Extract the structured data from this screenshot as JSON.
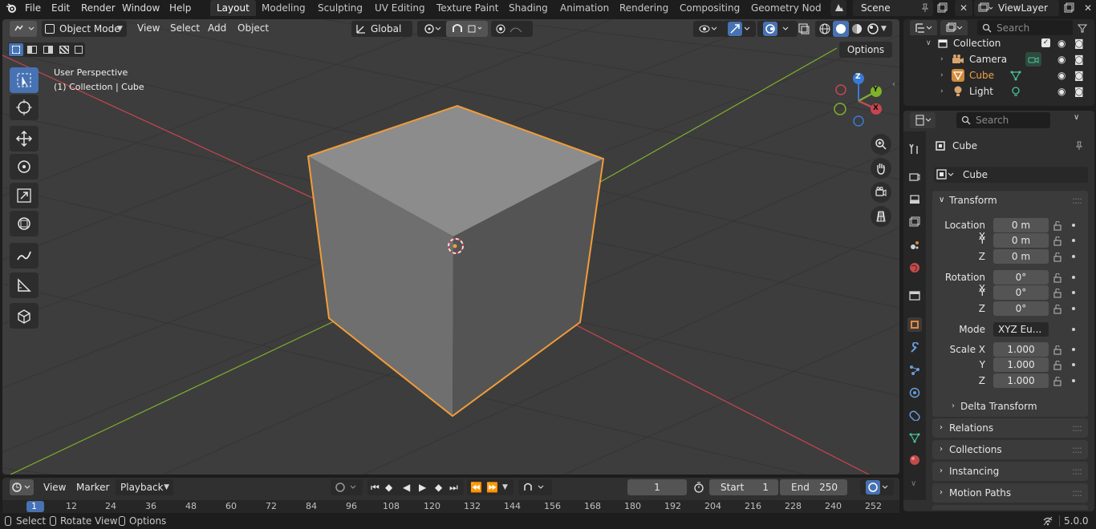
{
  "app": {
    "menu": [
      "File",
      "Edit",
      "Render",
      "Window",
      "Help"
    ],
    "workspaces": [
      "Layout",
      "Modeling",
      "Sculpting",
      "UV Editing",
      "Texture Paint",
      "Shading",
      "Animation",
      "Rendering",
      "Compositing",
      "Geometry Nodes"
    ],
    "active_workspace": "Layout",
    "scene_name": "Scene",
    "view_layer": "ViewLayer",
    "version": "5.0.0"
  },
  "viewport": {
    "mode": "Object Mode",
    "menus": [
      "View",
      "Select",
      "Add",
      "Object"
    ],
    "transform_orientation": "Global",
    "options_label": "Options",
    "perspective_label": "User Perspective",
    "context_label": "(1) Collection | Cube",
    "gizmo_axes": {
      "x": "X",
      "y": "Y",
      "z": "Z"
    },
    "colors": {
      "accent": "#4772b3",
      "selection": "#f29c38",
      "x_axis": "#c8454f",
      "y_axis": "#7fb12a",
      "z_axis": "#3a7ad6"
    }
  },
  "timeline": {
    "menus": [
      "View",
      "Marker",
      "Playback"
    ],
    "current_frame": "1",
    "start_label": "Start",
    "start_value": "1",
    "end_label": "End",
    "end_value": "250",
    "ruler": [
      "1",
      "12",
      "24",
      "36",
      "48",
      "60",
      "72",
      "84",
      "96",
      "108",
      "120",
      "132",
      "144",
      "156",
      "168",
      "180",
      "192",
      "204",
      "216",
      "228",
      "240",
      "252"
    ]
  },
  "outliner": {
    "search_placeholder": "Search",
    "collection": "Collection",
    "items": [
      {
        "name": "Camera",
        "icon": "camera-icon"
      },
      {
        "name": "Cube",
        "icon": "mesh-icon",
        "selected": true
      },
      {
        "name": "Light",
        "icon": "light-icon"
      }
    ]
  },
  "properties": {
    "search_placeholder": "Search",
    "object_name": "Cube",
    "data_name": "Cube",
    "transform_label": "Transform",
    "location_label": "Location X",
    "rotation_label": "Rotation X",
    "scale_label": "Scale X",
    "y_label": "Y",
    "z_label": "Z",
    "location": [
      "0 m",
      "0 m",
      "0 m"
    ],
    "rotation": [
      "0°",
      "0°",
      "0°"
    ],
    "mode_label": "Mode",
    "mode_value": "XYZ Eu...",
    "scale": [
      "1.000",
      "1.000",
      "1.000"
    ],
    "delta_transform": "Delta Transform",
    "sections": [
      "Relations",
      "Collections",
      "Instancing",
      "Motion Paths"
    ]
  },
  "statusbar": {
    "select": "Select",
    "rotate_view": "Rotate View",
    "options": "Options",
    "version": "5.0.0"
  }
}
